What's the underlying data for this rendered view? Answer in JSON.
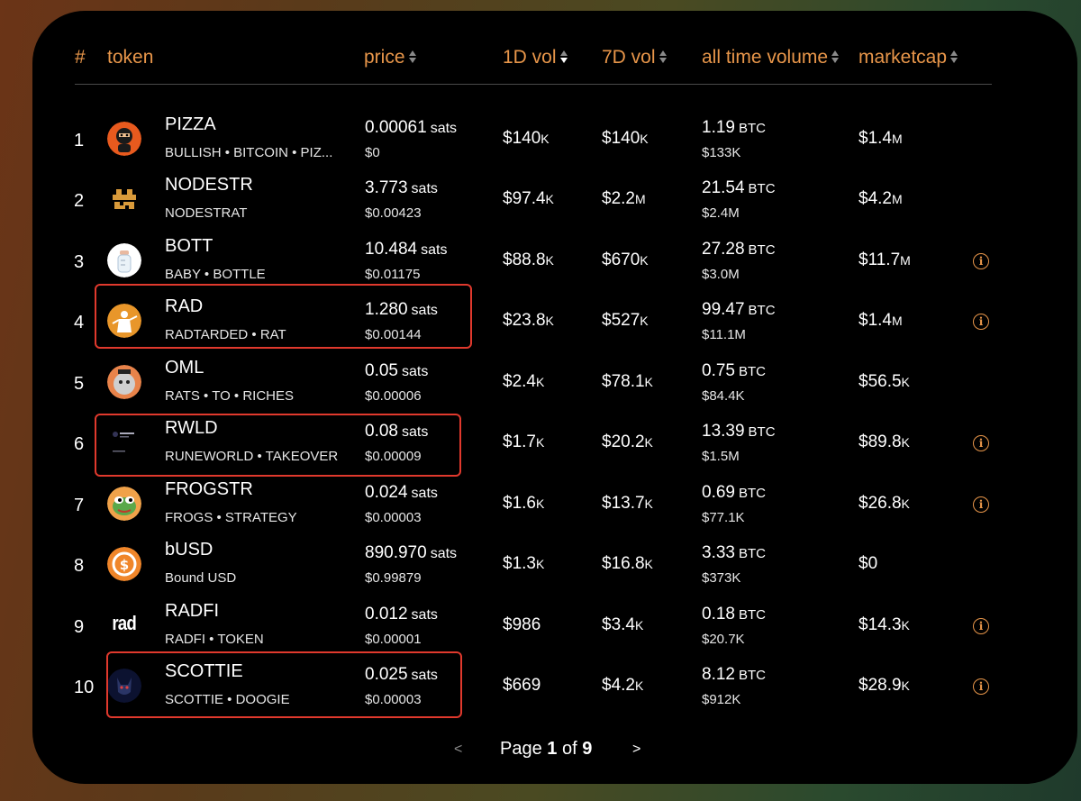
{
  "header": {
    "rank": "#",
    "token": "token",
    "price": "price",
    "vol1d": "1D vol",
    "vol7d": "7D vol",
    "all_time_volume": "all time volume",
    "marketcap": "marketcap"
  },
  "rows": [
    {
      "rank": "1",
      "name": "PIZZA",
      "sub": "BULLISH • BITCOIN • PIZ...",
      "price_sats": "0.00061",
      "price_unit": "sats",
      "price_usd": "$0",
      "vol1d": "$140",
      "vol1d_sfx": "K",
      "vol7d": "$140",
      "vol7d_sfx": "K",
      "atv_btc": "1.19",
      "atv_unit": "BTC",
      "atv_usd": "$133K",
      "mcap": "$1.4",
      "mcap_sfx": "M",
      "info": false,
      "avatar": "pizza-avatar"
    },
    {
      "rank": "2",
      "name": "NODESTR",
      "sub": "NODESTRAT",
      "price_sats": "3.773",
      "price_unit": "sats",
      "price_usd": "$0.00423",
      "vol1d": "$97.4",
      "vol1d_sfx": "K",
      "vol7d": "$2.2",
      "vol7d_sfx": "M",
      "atv_btc": "21.54",
      "atv_unit": "BTC",
      "atv_usd": "$2.4M",
      "mcap": "$4.2",
      "mcap_sfx": "M",
      "info": false,
      "avatar": "nodestr-avatar"
    },
    {
      "rank": "3",
      "name": "BOTT",
      "sub": "BABY • BOTTLE",
      "price_sats": "10.484",
      "price_unit": "sats",
      "price_usd": "$0.01175",
      "vol1d": "$88.8",
      "vol1d_sfx": "K",
      "vol7d": "$670",
      "vol7d_sfx": "K",
      "atv_btc": "27.28",
      "atv_unit": "BTC",
      "atv_usd": "$3.0M",
      "mcap": "$11.7",
      "mcap_sfx": "M",
      "info": true,
      "avatar": "bott-avatar"
    },
    {
      "rank": "4",
      "name": "RAD",
      "sub": "RADTARDED • RAT",
      "price_sats": "1.280",
      "price_unit": "sats",
      "price_usd": "$0.00144",
      "vol1d": "$23.8",
      "vol1d_sfx": "K",
      "vol7d": "$527",
      "vol7d_sfx": "K",
      "atv_btc": "99.47",
      "atv_unit": "BTC",
      "atv_usd": "$11.1M",
      "mcap": "$1.4",
      "mcap_sfx": "M",
      "info": true,
      "avatar": "rad-avatar"
    },
    {
      "rank": "5",
      "name": "OML",
      "sub": "RATS • TO • RICHES",
      "price_sats": "0.05",
      "price_unit": "sats",
      "price_usd": "$0.00006",
      "vol1d": "$2.4",
      "vol1d_sfx": "K",
      "vol7d": "$78.1",
      "vol7d_sfx": "K",
      "atv_btc": "0.75",
      "atv_unit": "BTC",
      "atv_usd": "$84.4K",
      "mcap": "$56.5",
      "mcap_sfx": "K",
      "info": false,
      "avatar": "oml-avatar"
    },
    {
      "rank": "6",
      "name": "RWLD",
      "sub": "RUNEWORLD • TAKEOVER",
      "price_sats": "0.08",
      "price_unit": "sats",
      "price_usd": "$0.00009",
      "vol1d": "$1.7",
      "vol1d_sfx": "K",
      "vol7d": "$20.2",
      "vol7d_sfx": "K",
      "atv_btc": "13.39",
      "atv_unit": "BTC",
      "atv_usd": "$1.5M",
      "mcap": "$89.8",
      "mcap_sfx": "K",
      "info": true,
      "avatar": "rwld-avatar"
    },
    {
      "rank": "7",
      "name": "FROGSTR",
      "sub": "FROGS • STRATEGY",
      "price_sats": "0.024",
      "price_unit": "sats",
      "price_usd": "$0.00003",
      "vol1d": "$1.6",
      "vol1d_sfx": "K",
      "vol7d": "$13.7",
      "vol7d_sfx": "K",
      "atv_btc": "0.69",
      "atv_unit": "BTC",
      "atv_usd": "$77.1K",
      "mcap": "$26.8",
      "mcap_sfx": "K",
      "info": true,
      "avatar": "frogstr-avatar"
    },
    {
      "rank": "8",
      "name": "bUSD",
      "sub": "Bound USD",
      "price_sats": "890.970",
      "price_unit": "sats",
      "price_usd": "$0.99879",
      "vol1d": "$1.3",
      "vol1d_sfx": "K",
      "vol7d": "$16.8",
      "vol7d_sfx": "K",
      "atv_btc": "3.33",
      "atv_unit": "BTC",
      "atv_usd": "$373K",
      "mcap": "$0",
      "mcap_sfx": "",
      "info": false,
      "avatar": "busd-avatar"
    },
    {
      "rank": "9",
      "name": "RADFI",
      "sub": "RADFI • TOKEN",
      "price_sats": "0.012",
      "price_unit": "sats",
      "price_usd": "$0.00001",
      "vol1d": "$986",
      "vol1d_sfx": "",
      "vol7d": "$3.4",
      "vol7d_sfx": "K",
      "atv_btc": "0.18",
      "atv_unit": "BTC",
      "atv_usd": "$20.7K",
      "mcap": "$14.3",
      "mcap_sfx": "K",
      "info": true,
      "avatar": "radfi-avatar"
    },
    {
      "rank": "10",
      "name": "SCOTTIE",
      "sub": "SCOTTIE • DOOGIE",
      "price_sats": "0.025",
      "price_unit": "sats",
      "price_usd": "$0.00003",
      "vol1d": "$669",
      "vol1d_sfx": "",
      "vol7d": "$4.2",
      "vol7d_sfx": "K",
      "atv_btc": "8.12",
      "atv_unit": "BTC",
      "atv_usd": "$912K",
      "mcap": "$28.9",
      "mcap_sfx": "K",
      "info": true,
      "avatar": "scottie-avatar"
    }
  ],
  "radfi_logo_text": "rad",
  "pagination": {
    "prev": "<",
    "next": ">",
    "page_label": "Page",
    "current": "1",
    "of_label": "of",
    "total": "9"
  },
  "colors": {
    "accent": "#e8964a",
    "highlight": "#e0392d",
    "panel": "#000000"
  }
}
